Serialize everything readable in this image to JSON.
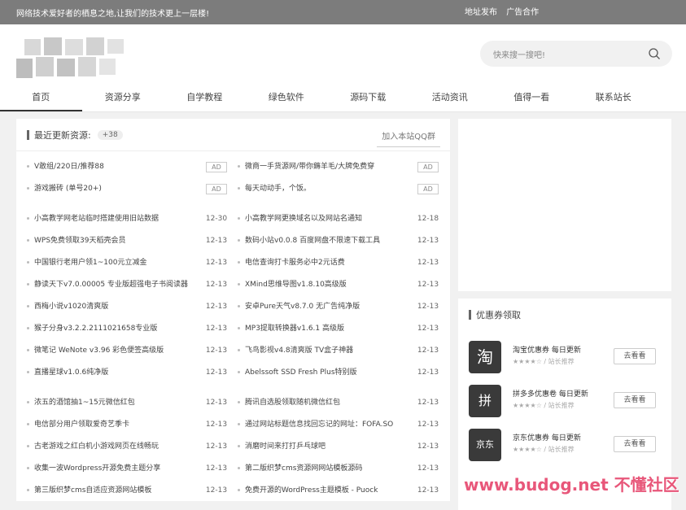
{
  "topbar": {
    "text": "网络技术爱好者的栖息之地,让我们的技术更上一层楼!",
    "links": [
      "地址发布",
      "广告合作"
    ]
  },
  "search": {
    "placeholder": "快来搜一搜吧!"
  },
  "nav": [
    "首页",
    "资源分享",
    "自学教程",
    "绿色软件",
    "源码下载",
    "活动资讯",
    "值得一看",
    "联系站长"
  ],
  "latest": {
    "title": "最近更新资源:",
    "count": "+38",
    "qq_link": "加入本站QQ群",
    "rows": [
      {
        "left": "V敢组/220日/推荐88",
        "ld": "AD",
        "right": "微商一手货源网/带你薅羊毛/大牌免费穿",
        "rd": "AD"
      },
      {
        "left": "游戏搬砖 (单号20+)",
        "ld": "AD",
        "right": "每天动动手，个饭。",
        "rd": "AD"
      },
      {
        "left": "小高教学网老站临时搭建使用旧站数据",
        "ld": "12-30",
        "right": "小高教学网更换域名以及网站名通知",
        "rd": "12-18"
      },
      {
        "left": "WPS免费领取39天稻壳会员",
        "ld": "12-13",
        "right": "数码小站v0.0.8 百度网盘不限速下载工具",
        "rd": "12-13"
      },
      {
        "left": "中国银行老用户领1~100元立减金",
        "ld": "12-13",
        "right": "电信查询打卡服务必中2元话费",
        "rd": "12-13"
      },
      {
        "left": "静读天下v7.0.00005 专业版超强电子书阅读器",
        "ld": "12-13",
        "right": "XMind思维导图v1.8.10高级版",
        "rd": "12-13"
      },
      {
        "left": "西梅小说v1020清爽版",
        "ld": "12-13",
        "right": "安卓Pure天气v8.7.0 无广告纯净版",
        "rd": "12-13"
      },
      {
        "left": "猴子分身v3.2.2.2111021658专业版",
        "ld": "12-13",
        "right": "MP3提取转换器v1.6.1 高级版",
        "rd": "12-13"
      },
      {
        "left": "微笔记 WeNote v3.96 彩色便签高级版",
        "ld": "12-13",
        "right": "飞鸟影视v4.8清爽版 TV盒子神器",
        "rd": "12-13"
      },
      {
        "left": "直播星球v1.0.6纯净版",
        "ld": "12-13",
        "right": "Abelssoft SSD Fresh Plus特别版",
        "rd": "12-13"
      },
      {
        "left": "浓五的酒馆抽1~15元微信红包",
        "ld": "12-13",
        "right": "腾讯自选股领取随机微信红包",
        "rd": "12-13"
      },
      {
        "left": "电信部分用户领取爱奇艺季卡",
        "ld": "12-13",
        "right": "通过网站标题信息找回忘记的网址：FOFA.SO",
        "rd": "12-13"
      },
      {
        "left": "古老游戏之红白机小游戏网页在线畅玩",
        "ld": "12-13",
        "right": "消磨时间来打打乒乓球吧",
        "rd": "12-13"
      },
      {
        "left": "收集一波Wordpress开源免费主题分享",
        "ld": "12-13",
        "right": "第二版织梦cms资源网网站模板源码",
        "rd": "12-13"
      },
      {
        "left": "第三版织梦cms自适应资源网站模板",
        "ld": "12-13",
        "right": "免费开源的WordPress主题模板 - Puock",
        "rd": "12-13"
      }
    ]
  },
  "coupons": {
    "title": "优惠券领取",
    "items": [
      {
        "logo": "淘",
        "name": "淘宝优惠券 每日更新",
        "rating": "★★★★☆ / 站长推荐",
        "button": "去看看"
      },
      {
        "logo": "拼",
        "name": "拼多多优惠卷 每日更新",
        "rating": "★★★★☆ / 站长推荐",
        "button": "去看看"
      },
      {
        "logo": "京东",
        "name": "京东优惠券 每日更新",
        "rating": "★★★★☆ / 站长推荐",
        "button": "去看看"
      }
    ]
  },
  "watermark": "www.budog.net 不懂社区",
  "colors": {
    "topbar": "#7c7c7c",
    "background": "#f1f1f1",
    "watermark": "#e8577a"
  }
}
